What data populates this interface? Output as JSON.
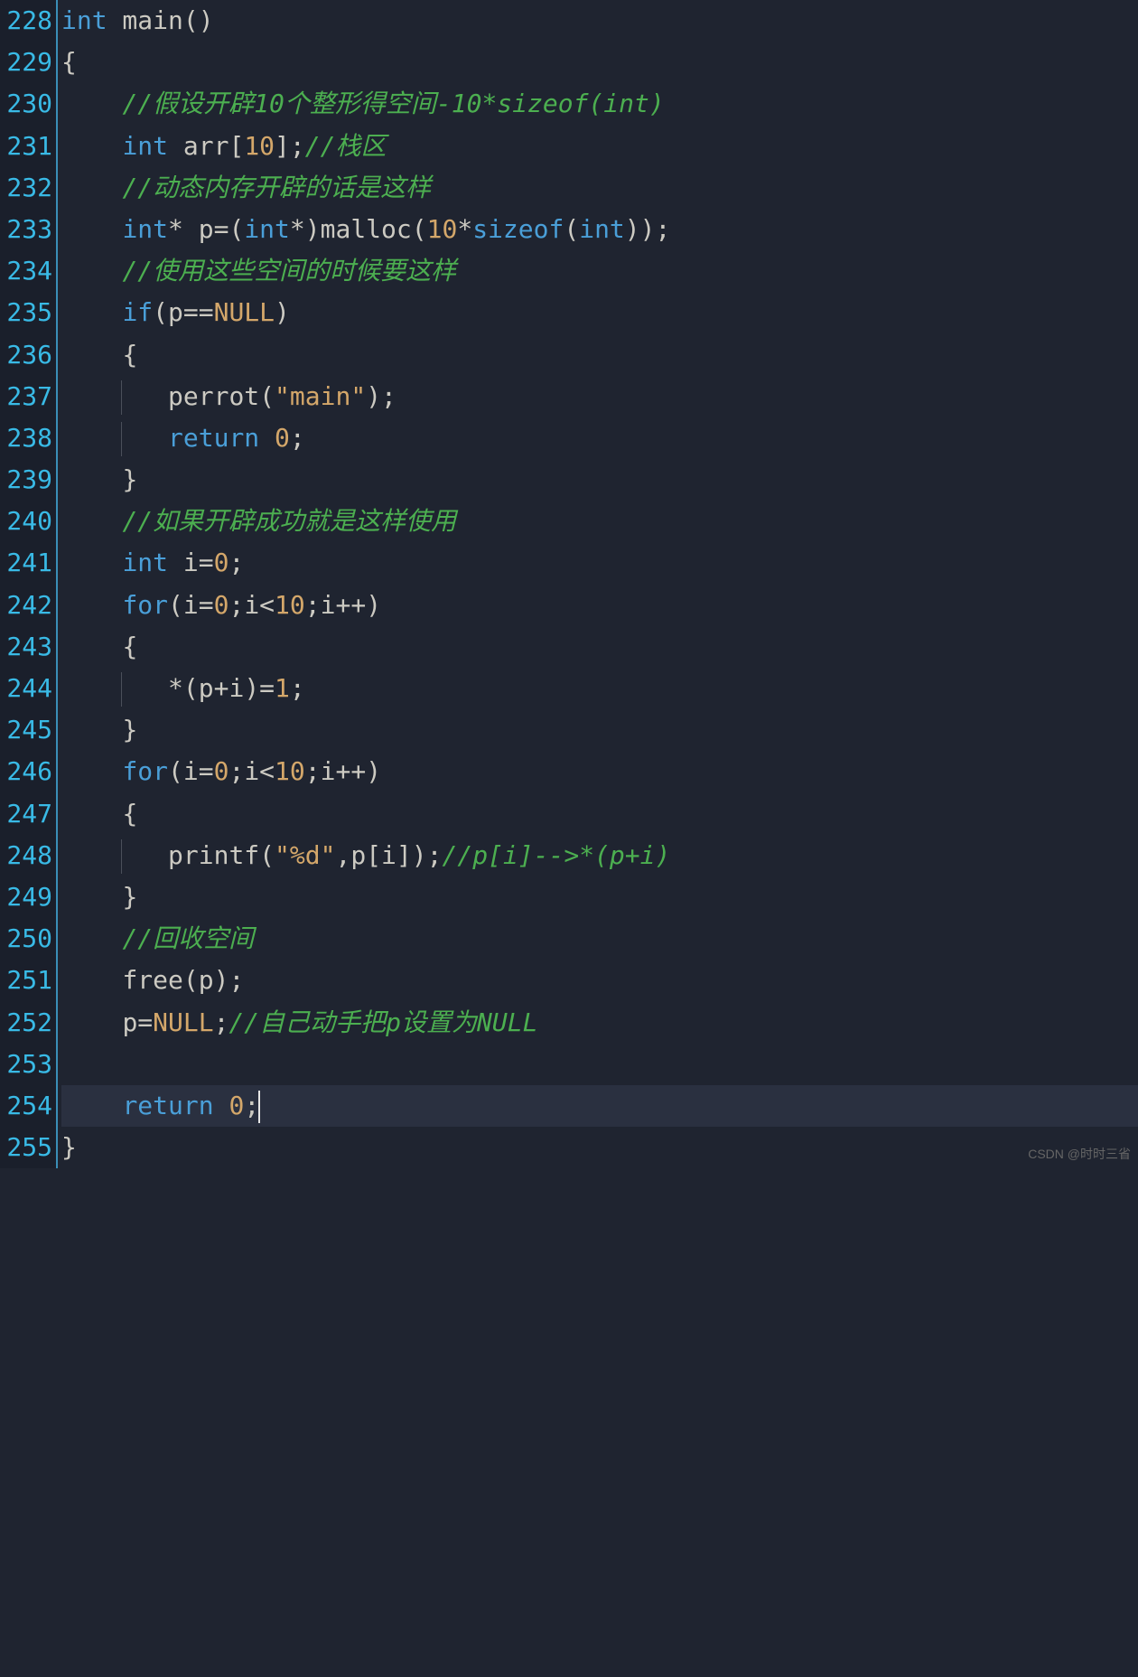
{
  "gutter": {
    "start": 228,
    "end": 255
  },
  "code": {
    "l228": {
      "kw1": "int",
      "fn": " main",
      "p": "()"
    },
    "l229": {
      "brace": "{"
    },
    "l230": {
      "indent": "    ",
      "cmt": "//假设开辟10个整形得空间-10*sizeof(int)"
    },
    "l231": {
      "indent": "    ",
      "kw": "int",
      "sp": " ",
      "id": "arr",
      "b1": "[",
      "num": "10",
      "b2": "]",
      "semi": ";",
      "cmt": "//栈区"
    },
    "l232": {
      "indent": "    ",
      "cmt": "//动态内存开辟的话是这样"
    },
    "l233": {
      "indent": "    ",
      "kw": "int",
      "star": "*",
      "sp": " ",
      "id": "p",
      "eq": "=(",
      "kw2": "int",
      "star2": "*",
      "p1": ")",
      "fn": "malloc",
      "p2": "(",
      "num": "10",
      "star3": "*",
      "so": "sizeof",
      "p3": "(",
      "kw3": "int",
      "p4": "))",
      "semi": ";"
    },
    "l234": {
      "indent": "    ",
      "cmt": "//使用这些空间的时候要这样"
    },
    "l235": {
      "indent": "    ",
      "kw": "if",
      "p1": "(",
      "id": "p",
      "op": "==",
      "null": "NULL",
      "p2": ")"
    },
    "l236": {
      "indent": "    ",
      "brace": "{"
    },
    "l237": {
      "indent": "        ",
      "fn": "perrot",
      "p1": "(",
      "str": "\"main\"",
      "p2": ")",
      "semi": ";"
    },
    "l238": {
      "indent": "        ",
      "kw": "return",
      "sp": " ",
      "num": "0",
      "semi": ";"
    },
    "l239": {
      "indent": "    ",
      "brace": "}"
    },
    "l240": {
      "indent": "    ",
      "cmt": "//如果开辟成功就是这样使用"
    },
    "l241": {
      "indent": "    ",
      "kw": "int",
      "sp": " ",
      "id": "i",
      "eq": "=",
      "num": "0",
      "semi": ";"
    },
    "l242": {
      "indent": "    ",
      "kw": "for",
      "p1": "(",
      "id1": "i",
      "eq": "=",
      "num1": "0",
      "s1": ";",
      "id2": "i",
      "lt": "<",
      "num2": "10",
      "s2": ";",
      "id3": "i",
      "inc": "++",
      "p2": ")"
    },
    "l243": {
      "indent": "    ",
      "brace": "{"
    },
    "l244": {
      "indent": "        ",
      "star": "*",
      "p1": "(",
      "id1": "p",
      "plus": "+",
      "id2": "i",
      "p2": ")",
      "eq": "=",
      "num": "1",
      "semi": ";"
    },
    "l245": {
      "indent": "    ",
      "brace": "}"
    },
    "l246": {
      "indent": "    ",
      "kw": "for",
      "p1": "(",
      "id1": "i",
      "eq": "=",
      "num1": "0",
      "s1": ";",
      "id2": "i",
      "lt": "<",
      "num2": "10",
      "s2": ";",
      "id3": "i",
      "inc": "++",
      "p2": ")"
    },
    "l247": {
      "indent": "    ",
      "brace": "{"
    },
    "l248": {
      "indent": "        ",
      "fn": "printf",
      "p1": "(",
      "str": "\"%d\"",
      "c": ",",
      "id": "p",
      "b1": "[",
      "id2": "i",
      "b2": "]",
      "p2": ")",
      "semi": ";",
      "cmt": "//p[i]-->*(p+i)"
    },
    "l249": {
      "indent": "    ",
      "brace": "}"
    },
    "l250": {
      "indent": "    ",
      "cmt": "//回收空间"
    },
    "l251": {
      "indent": "    ",
      "fn": "free",
      "p1": "(",
      "id": "p",
      "p2": ")",
      "semi": ";"
    },
    "l252": {
      "indent": "    ",
      "id": "p",
      "eq": "=",
      "null": "NULL",
      "semi": ";",
      "cmt": "//自己动手把p设置为NULL"
    },
    "l253": {
      "indent": ""
    },
    "l254": {
      "indent": "    ",
      "kw": "return",
      "sp": " ",
      "num": "0",
      "semi": ";"
    },
    "l255": {
      "brace": "}"
    }
  },
  "watermark": "CSDN @时时三省"
}
